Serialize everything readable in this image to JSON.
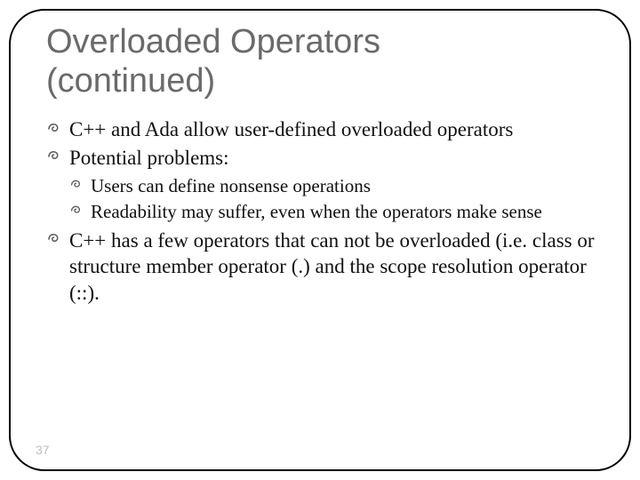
{
  "title_line1": "Overloaded Operators",
  "title_line2": "(continued)",
  "bullets": {
    "b1": "C++ and Ada allow user-defined overloaded operators",
    "b2": "Potential problems:",
    "b2_sub1": "Users can define nonsense operations",
    "b2_sub2": "Readability may suffer, even when the operators make sense",
    "b3": "C++ has a few operators that can not be overloaded (i.e. class or structure member operator (.) and the scope resolution operator (::)."
  },
  "page_number": "37"
}
